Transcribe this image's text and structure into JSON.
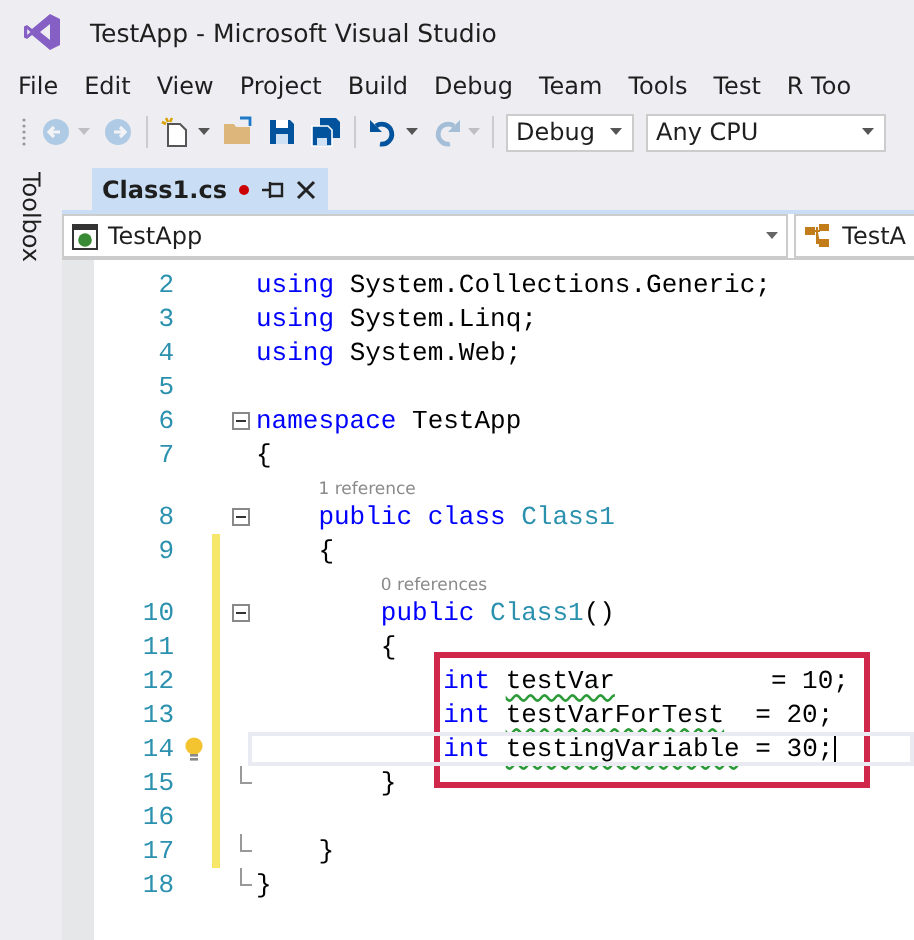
{
  "window": {
    "title": "TestApp - Microsoft Visual Studio"
  },
  "menu": [
    "File",
    "Edit",
    "View",
    "Project",
    "Build",
    "Debug",
    "Team",
    "Tools",
    "Test",
    "R Too"
  ],
  "toolbar": {
    "items": [
      {
        "kind": "back",
        "disabled": true,
        "dropdown": true
      },
      {
        "kind": "forward",
        "disabled": true,
        "dropdown": false
      },
      {
        "kind": "new-project",
        "disabled": false,
        "dropdown": true
      },
      {
        "kind": "open",
        "disabled": false,
        "dropdown": false
      },
      {
        "kind": "save",
        "disabled": false,
        "dropdown": false
      },
      {
        "kind": "save-all",
        "disabled": false,
        "dropdown": false
      },
      {
        "kind": "undo",
        "disabled": false,
        "dropdown": true
      },
      {
        "kind": "redo",
        "disabled": true,
        "dropdown": true
      }
    ],
    "configuration": "Debug",
    "platform": "Any CPU"
  },
  "side_panel": {
    "label": "Toolbox"
  },
  "tabs": [
    {
      "label": "Class1.cs",
      "selected": true,
      "modified": true
    }
  ],
  "nav_bar": {
    "project": "TestApp",
    "type": "TestA"
  },
  "lines": [
    {
      "number": "2",
      "tokens": [
        {
          "kind": "keyword",
          "text": "using "
        },
        {
          "kind": "plain",
          "text": "System.Collections.Generic;"
        }
      ],
      "changed": false,
      "collapsible": false,
      "fold_end": false,
      "boxed": false
    },
    {
      "number": "3",
      "tokens": [
        {
          "kind": "keyword",
          "text": "using "
        },
        {
          "kind": "plain",
          "text": "System.Linq;"
        }
      ],
      "changed": false,
      "collapsible": false,
      "fold_end": false,
      "boxed": false
    },
    {
      "number": "4",
      "tokens": [
        {
          "kind": "keyword",
          "text": "using "
        },
        {
          "kind": "plain",
          "text": "System.Web;"
        }
      ],
      "changed": false,
      "collapsible": false,
      "fold_end": false,
      "boxed": false
    },
    {
      "number": "5",
      "changed": false,
      "collapsible": false,
      "fold_end": false,
      "boxed": false
    },
    {
      "number": "6",
      "tokens": [
        {
          "kind": "keyword",
          "text": "namespace "
        },
        {
          "kind": "plain",
          "text": "TestApp"
        }
      ],
      "changed": false,
      "collapsible": true,
      "fold_end": false,
      "boxed": false
    },
    {
      "number": "7",
      "tokens": [
        {
          "kind": "plain",
          "text": "{"
        }
      ],
      "changed": false,
      "collapsible": false,
      "fold_end": false,
      "boxed": false
    },
    {
      "number": "8",
      "codelens": "1 reference",
      "tokens": [
        {
          "kind": "keyword",
          "text": "    public class "
        },
        {
          "kind": "type",
          "text": "Class1"
        }
      ],
      "changed": false,
      "collapsible": true,
      "fold_end": false,
      "boxed": false
    },
    {
      "number": "9",
      "tokens": [
        {
          "kind": "plain",
          "text": "    {"
        }
      ],
      "changed": true,
      "collapsible": false,
      "fold_end": false,
      "boxed": false
    },
    {
      "number": "10",
      "codelens": "0 references",
      "tokens": [
        {
          "kind": "keyword",
          "text": "        public "
        },
        {
          "kind": "type",
          "text": "Class1"
        },
        {
          "kind": "plain",
          "text": "()"
        }
      ],
      "changed": true,
      "collapsible": true,
      "fold_end": false,
      "boxed": false
    },
    {
      "number": "11",
      "tokens": [
        {
          "kind": "plain",
          "text": "        {"
        }
      ],
      "changed": true,
      "collapsible": false,
      "fold_end": false,
      "boxed": false
    },
    {
      "number": "12",
      "tokens": [
        {
          "kind": "keyword",
          "text": "            int "
        },
        {
          "kind": "plain",
          "text": "testVar",
          "squiggle": true
        },
        {
          "kind": "plain",
          "text": "          = 10;"
        }
      ],
      "changed": true,
      "collapsible": false,
      "fold_end": false,
      "boxed": true
    },
    {
      "number": "13",
      "tokens": [
        {
          "kind": "keyword",
          "text": "            int "
        },
        {
          "kind": "plain",
          "text": "testVarForTest",
          "squiggle": true
        },
        {
          "kind": "plain",
          "text": "  = 20;"
        }
      ],
      "changed": true,
      "collapsible": false,
      "fold_end": false,
      "boxed": true
    },
    {
      "number": "14",
      "current": true,
      "lightbulb": true,
      "caret": true,
      "tokens": [
        {
          "kind": "keyword",
          "text": "            int "
        },
        {
          "kind": "plain",
          "text": "testingVariable",
          "squiggle": true
        },
        {
          "kind": "plain",
          "text": " = 30;"
        }
      ],
      "changed": true,
      "collapsible": false,
      "fold_end": false,
      "boxed": true
    },
    {
      "number": "15",
      "tokens": [
        {
          "kind": "plain",
          "text": "        }"
        }
      ],
      "changed": true,
      "collapsible": false,
      "fold_end": true,
      "boxed": false
    },
    {
      "number": "16",
      "changed": true,
      "collapsible": false,
      "fold_end": false,
      "boxed": false
    },
    {
      "number": "17",
      "tokens": [
        {
          "kind": "plain",
          "text": "    }"
        }
      ],
      "changed": true,
      "collapsible": false,
      "fold_end": true,
      "boxed": false
    },
    {
      "number": "18",
      "tokens": [
        {
          "kind": "plain",
          "text": "}"
        }
      ],
      "changed": false,
      "collapsible": false,
      "fold_end": true,
      "boxed": false
    }
  ]
}
